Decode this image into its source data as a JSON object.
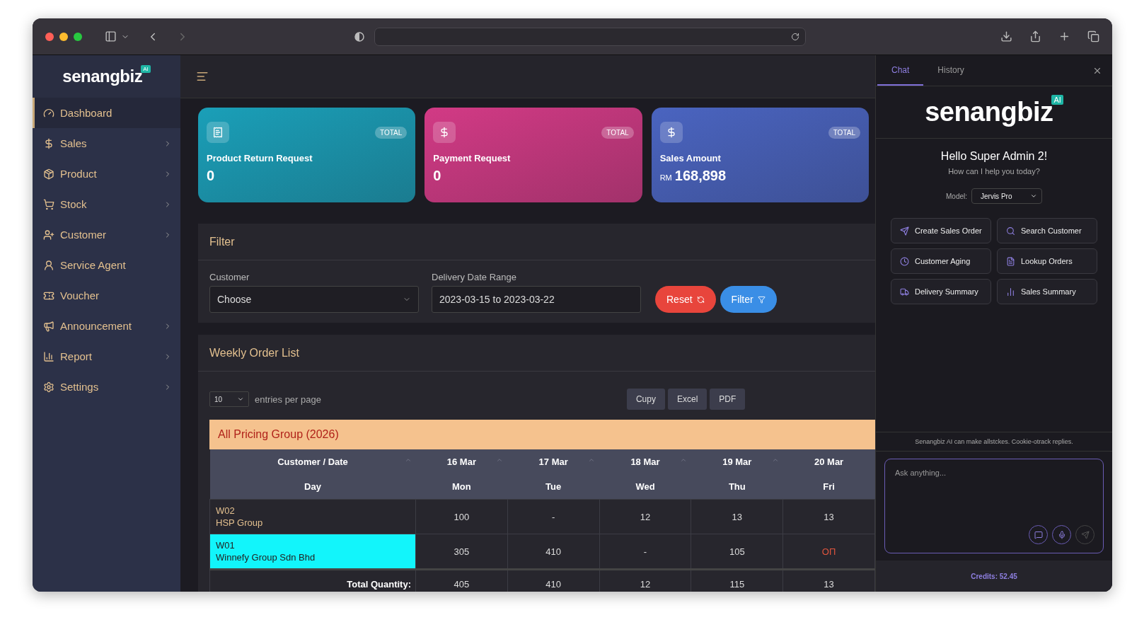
{
  "sidebar": {
    "logo": "senangbiz",
    "logo_badge": "AI",
    "items": [
      {
        "label": "Dashboard",
        "selected": true,
        "has_children": false
      },
      {
        "label": "Sales",
        "selected": false,
        "has_children": true
      },
      {
        "label": "Product",
        "selected": false,
        "has_children": true
      },
      {
        "label": "Stock",
        "selected": false,
        "has_children": true
      },
      {
        "label": "Customer",
        "selected": false,
        "has_children": true
      },
      {
        "label": "Service Agent",
        "selected": false,
        "has_children": false
      },
      {
        "label": "Voucher",
        "selected": false,
        "has_children": false
      },
      {
        "label": "Announcement",
        "selected": false,
        "has_children": true
      },
      {
        "label": "Report",
        "selected": false,
        "has_children": true
      },
      {
        "label": "Settings",
        "selected": false,
        "has_children": true
      }
    ]
  },
  "cards": [
    {
      "title": "Product Return Request",
      "badge": "TOTAL",
      "value": "0",
      "color": "#1a9fb8"
    },
    {
      "title": "Payment Request",
      "badge": "TOTAL",
      "value": "0",
      "color": "#d23a85"
    },
    {
      "title": "Sales Amount",
      "badge": "TOTAL",
      "value": "168,898",
      "prefix": "RM",
      "color": "#4a64c0"
    }
  ],
  "filter": {
    "title": "Filter",
    "customer_label": "Customer",
    "customer_value": "Choose",
    "date_label": "Delivery Date Range",
    "date_value": "2023-03-15 to 2023-03-22",
    "reset": "Reset",
    "apply": "Filter"
  },
  "orders": {
    "title": "Weekly Order List",
    "page_size": "10",
    "page_size_label": "entries per page",
    "exports": [
      "Cupy",
      "Excel",
      "PDF"
    ],
    "group": "All Pricing Group (2026)",
    "header_dates": [
      "Customer / Date",
      "16 Mar",
      "17 Mar",
      "18 Mar",
      "19 Mar",
      "20 Mar"
    ],
    "header_days": [
      "Day",
      "Mon",
      "Tue",
      "Wed",
      "Thu",
      "Fri"
    ],
    "rows": [
      {
        "code": "W02",
        "name": "HSP Group",
        "selected": false,
        "cells": [
          {
            "text": "100",
            "alert": false
          },
          {
            "text": "-",
            "alert": false
          },
          {
            "text": "12",
            "alert": false
          },
          {
            "text": "13",
            "alert": false
          },
          {
            "text": "13",
            "alert": false
          }
        ]
      },
      {
        "code": "W01",
        "name": "Winnefy Group Sdn Bhd",
        "selected": true,
        "cells": [
          {
            "text": "305",
            "alert": false
          },
          {
            "text": "410",
            "alert": false
          },
          {
            "text": "-",
            "alert": false
          },
          {
            "text": "105",
            "alert": false
          },
          {
            "text": "ОП",
            "alert": true
          }
        ]
      }
    ],
    "total_label": "Total Quantity:",
    "totals": [
      "405",
      "410",
      "12",
      "115",
      "13"
    ]
  },
  "chat": {
    "tabs": [
      {
        "label": "Chat",
        "selected": true
      },
      {
        "label": "History",
        "selected": false
      }
    ],
    "logo": "senangbiz",
    "logo_badge": "AI",
    "greeting": "Hello Super Admin 2!",
    "subtitle": "How can I help you today?",
    "model_label": "Model:",
    "model": "Jervis Pro",
    "actions": [
      "Create Sales Order",
      "Search Customer",
      "Customer Aging",
      "Lookup Orders",
      "Delivery Summary",
      "Sales Summary"
    ],
    "disclaimer": "Senangbiz AI can make allstckes. Cookie-otrack replies.",
    "placeholder": "Ask anything...",
    "credits": "Credits: 52.45"
  }
}
